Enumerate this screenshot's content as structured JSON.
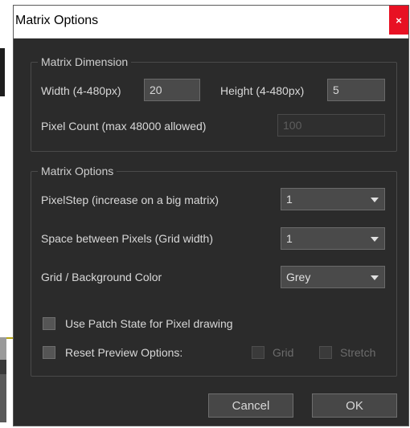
{
  "window": {
    "title": "Matrix Options",
    "close_glyph": "×"
  },
  "dimension": {
    "legend": "Matrix Dimension",
    "width_label": "Width (4-480px)",
    "width_value": "20",
    "height_label": "Height (4-480px)",
    "height_value": "5",
    "pixel_count_label": "Pixel Count (max 48000 allowed)",
    "pixel_count_value": "100"
  },
  "options": {
    "legend": "Matrix Options",
    "pixelstep_label": "PixelStep (increase on a big matrix)",
    "pixelstep_value": "1",
    "spacing_label": "Space between Pixels (Grid width)",
    "spacing_value": "1",
    "color_label": "Grid / Background Color",
    "color_value": "Grey",
    "patch_state_label": "Use Patch State for Pixel drawing",
    "reset_preview_label": "Reset Preview Options:",
    "grid_label": "Grid",
    "stretch_label": "Stretch"
  },
  "buttons": {
    "cancel": "Cancel",
    "ok": "OK"
  },
  "colors": {
    "dialog_bg": "#2b2b2b",
    "close_red": "#e81123",
    "field_bg": "#4a4a4a"
  }
}
